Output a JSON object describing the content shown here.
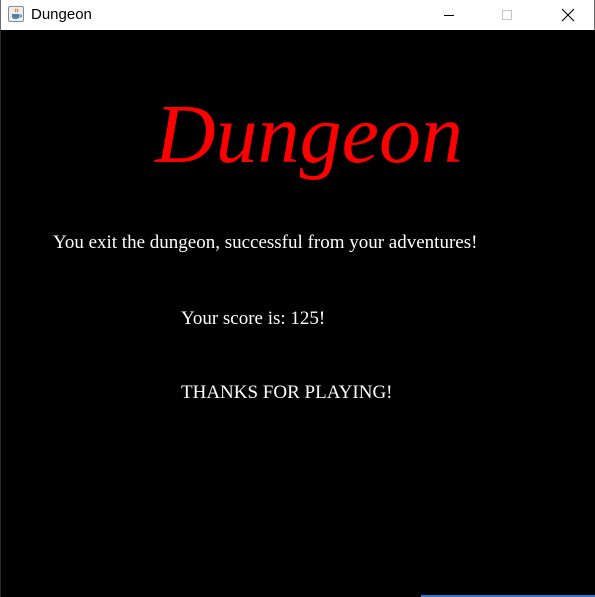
{
  "window": {
    "title": "Dungeon",
    "icon": "java-cup-icon",
    "controls": {
      "minimize": "minimize-icon",
      "maximize": "maximize-icon",
      "close": "close-icon"
    }
  },
  "game": {
    "title": "Dungeon",
    "exit_message": "You exit the dungeon, successful from your adventures!",
    "score_text": "Your score is: 125!",
    "thanks_text": "THANKS FOR PLAYING!"
  },
  "colors": {
    "background": "#000000",
    "title": "#ff0000",
    "text": "#ffffff"
  }
}
